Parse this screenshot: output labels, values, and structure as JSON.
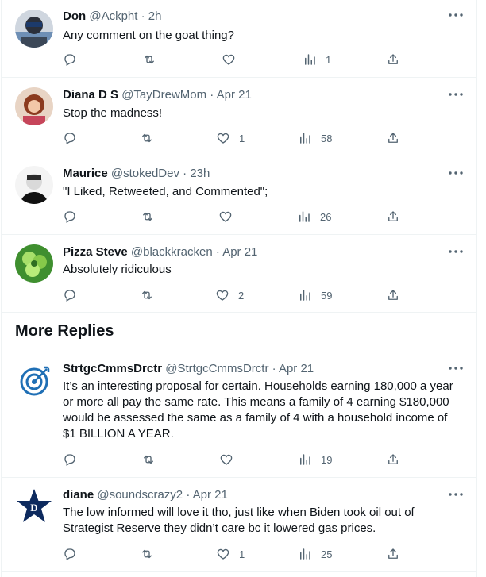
{
  "replies": [
    {
      "name": "Don",
      "handle": "@Ackpht",
      "time": "2h",
      "text": "Any comment on the goat thing?",
      "counts": {
        "reply": "",
        "retweet": "",
        "like": "",
        "views": "1"
      }
    },
    {
      "name": "Diana D S",
      "handle": "@TayDrewMom",
      "time": "Apr 21",
      "text": "Stop the madness!",
      "counts": {
        "reply": "",
        "retweet": "",
        "like": "1",
        "views": "58"
      }
    },
    {
      "name": "Maurice",
      "handle": "@stokedDev",
      "time": "23h",
      "text": "\"I Liked, Retweeted, and Commented\";",
      "counts": {
        "reply": "",
        "retweet": "",
        "like": "",
        "views": "26"
      }
    },
    {
      "name": "Pizza Steve",
      "handle": "@blackkracken",
      "time": "Apr 21",
      "text": "Absolutely ridiculous",
      "counts": {
        "reply": "",
        "retweet": "",
        "like": "2",
        "views": "59"
      }
    }
  ],
  "more_replies_title": "More Replies",
  "more_replies": [
    {
      "name": "StrtgcCmmsDrctr",
      "handle": "@StrtgcCmmsDrctr",
      "time": "Apr 21",
      "text": "It’s an interesting proposal for certain. Households earning 180,000 a year or more all pay the same rate. This means a family of 4 earning $180,000 would be assessed the same as a family of 4 with a household income of $1 BILLION A YEAR.",
      "counts": {
        "reply": "",
        "retweet": "",
        "like": "",
        "views": "19"
      }
    },
    {
      "name": "diane",
      "handle": "@soundscrazy2",
      "time": "Apr 21",
      "text": "The low informed will love it tho, just like when Biden took oil out of Strategist Reserve they didn’t care bc it lowered gas prices.",
      "counts": {
        "reply": "",
        "retweet": "",
        "like": "1",
        "views": "25"
      }
    }
  ],
  "separator": "·",
  "colors": {
    "text": "#0f1419",
    "secondary": "#536471",
    "border": "#eff3f4"
  },
  "icons": [
    "reply-icon",
    "retweet-icon",
    "like-icon",
    "views-icon",
    "share-icon",
    "more-icon"
  ]
}
